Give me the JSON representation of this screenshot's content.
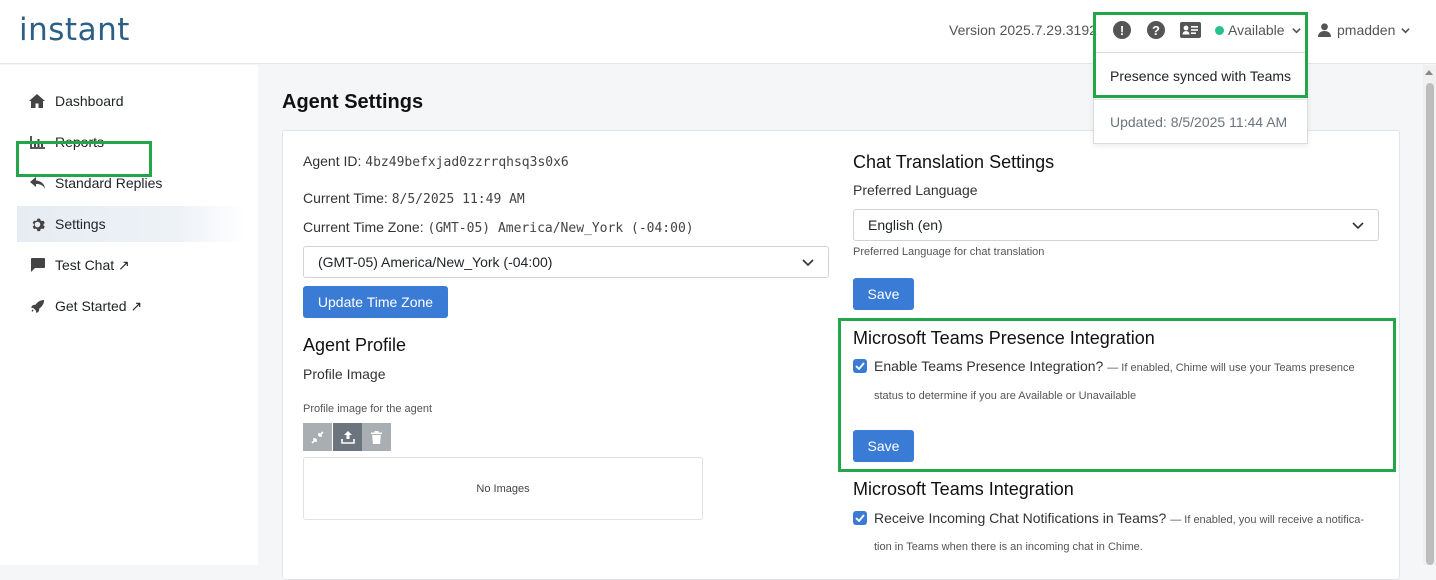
{
  "header": {
    "logo": "instant",
    "version": "Version 2025.7.29.3192",
    "status": "Available",
    "username": "pmadden",
    "icons": [
      "alert-icon",
      "help-icon",
      "id-card-icon",
      "user-icon"
    ]
  },
  "presence_dropdown": {
    "item1": "Presence synced with Teams",
    "item2": "Updated: 8/5/2025 11:44 AM"
  },
  "sidebar": {
    "items": [
      {
        "label": "Dashboard",
        "icon": "home-icon"
      },
      {
        "label": "Reports",
        "icon": "chart-icon"
      },
      {
        "label": "Standard Replies",
        "icon": "reply-icon"
      },
      {
        "label": "Settings",
        "icon": "gear-icon"
      },
      {
        "label": "Test Chat ↗",
        "icon": "chat-icon"
      },
      {
        "label": "Get Started ↗",
        "icon": "rocket-icon"
      }
    ]
  },
  "page": {
    "title": "Agent Settings",
    "agent_id_label": "Agent ID:",
    "agent_id": "4bz49befxjad0zzrrqhsq3s0x6",
    "current_time_label": "Current Time:",
    "current_time": "8/5/2025 11:49 AM",
    "tz_label": "Current Time Zone:",
    "tz_value": "(GMT-05) America/New_York (-04:00)",
    "tz_select": "(GMT-05) America/New_York (-04:00)",
    "update_tz_button": "Update Time Zone",
    "profile_heading": "Agent Profile",
    "profile_image_label": "Profile Image",
    "profile_image_help": "Profile image for the agent",
    "no_images": "No Images"
  },
  "translation": {
    "heading": "Chat Translation Settings",
    "label": "Preferred Language",
    "select_value": "English (en)",
    "help": "Preferred Language for chat translation",
    "save": "Save"
  },
  "presence": {
    "heading": "Microsoft Teams Presence Integration",
    "checkbox_label": "Enable Teams Presence Integration?",
    "note": "— If enabled, Chime will use your Teams presence",
    "note_cont": "status to determine if you are Available or Unavailable",
    "save": "Save"
  },
  "teams": {
    "heading": "Microsoft Teams Integration",
    "checkbox_label": "Receive Incoming Chat Notifications in Teams?",
    "note": "— If enabled, you will receive a notifica-",
    "note_cont": "tion in Teams when there is an incoming chat in Chime."
  },
  "colors": {
    "primary": "#3a7bd5",
    "highlight": "#23a64a",
    "status_dot": "#27c28a",
    "logo": "#2b5f87"
  }
}
